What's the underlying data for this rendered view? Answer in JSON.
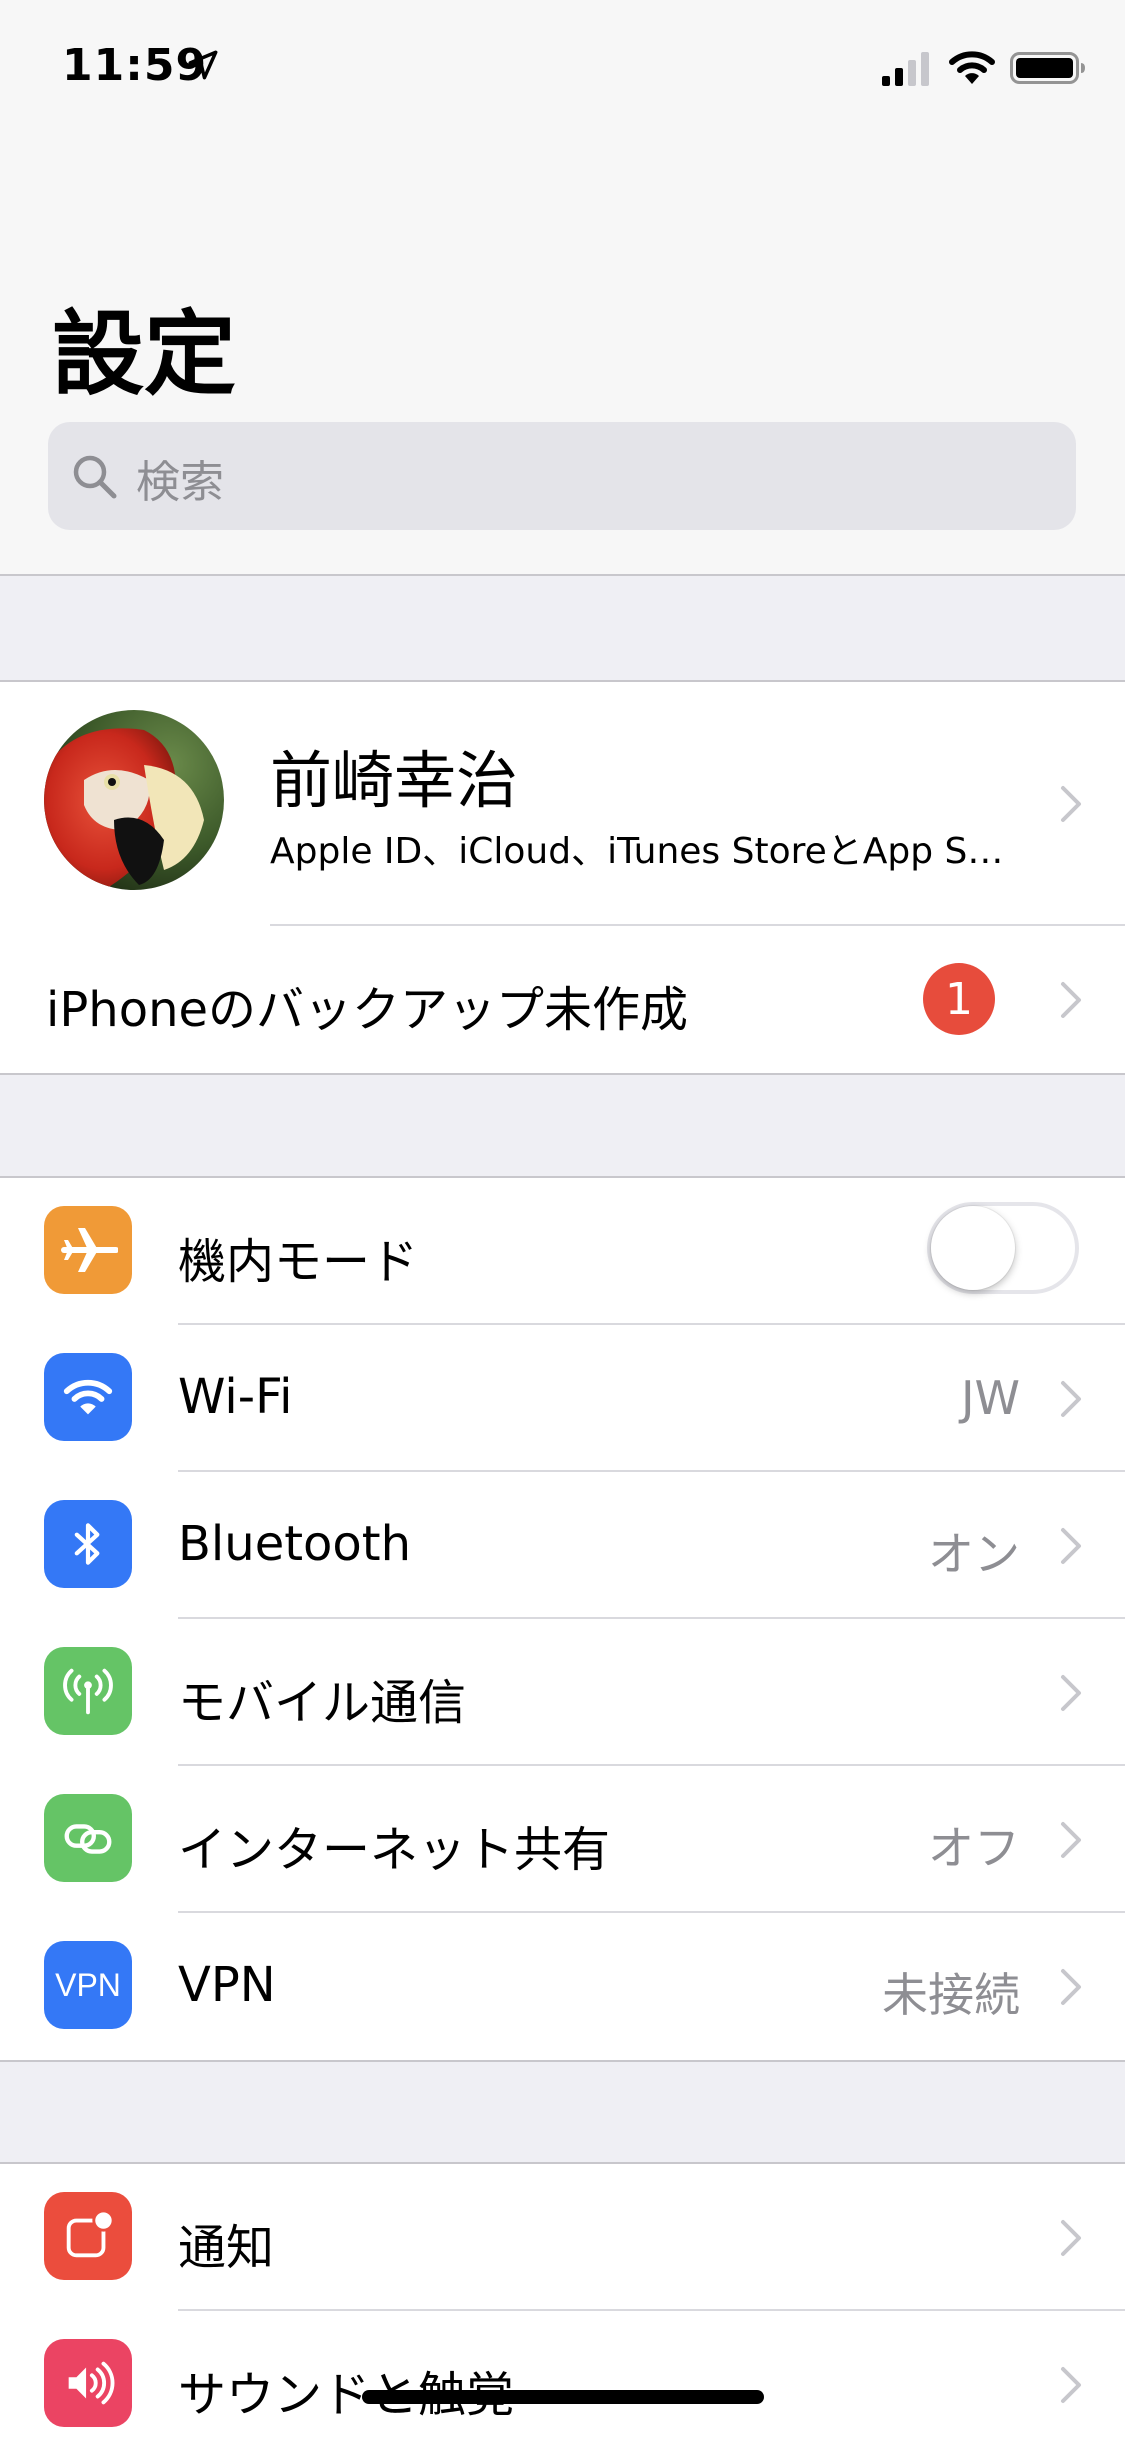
{
  "status_bar": {
    "time": "11:59",
    "icons": [
      "location-arrow-icon",
      "cellular-signal-icon",
      "wifi-icon",
      "battery-icon"
    ]
  },
  "header": {
    "title": "設定",
    "search_placeholder": "検索"
  },
  "profile": {
    "name": "前崎幸治",
    "subtitle": "Apple ID、iCloud、iTunes StoreとApp S…"
  },
  "backup": {
    "label": "iPhoneのバックアップ未作成",
    "badge": "1"
  },
  "connectivity": {
    "items": [
      {
        "label": "機内モード",
        "value": "",
        "icon": "airplane-icon",
        "color": "#f09a37",
        "toggle_on": false
      },
      {
        "label": "Wi-Fi",
        "value": "JW",
        "icon": "wifi-icon",
        "color": "#3478f6"
      },
      {
        "label": "Bluetooth",
        "value": "オン",
        "icon": "bluetooth-icon",
        "color": "#3478f6"
      },
      {
        "label": "モバイル通信",
        "value": "",
        "icon": "cellular-antenna-icon",
        "color": "#65c466"
      },
      {
        "label": "インターネット共有",
        "value": "オフ",
        "icon": "hotspot-link-icon",
        "color": "#65c466"
      },
      {
        "label": "VPN",
        "value": "未接続",
        "icon": "vpn-icon",
        "color": "#3478f6",
        "icon_text": "VPN"
      }
    ]
  },
  "notifications": {
    "items": [
      {
        "label": "通知",
        "icon": "notifications-icon",
        "color": "#eb4d3d"
      },
      {
        "label": "サウンドと触覚",
        "icon": "sound-icon",
        "color": "#eb4463"
      }
    ]
  }
}
